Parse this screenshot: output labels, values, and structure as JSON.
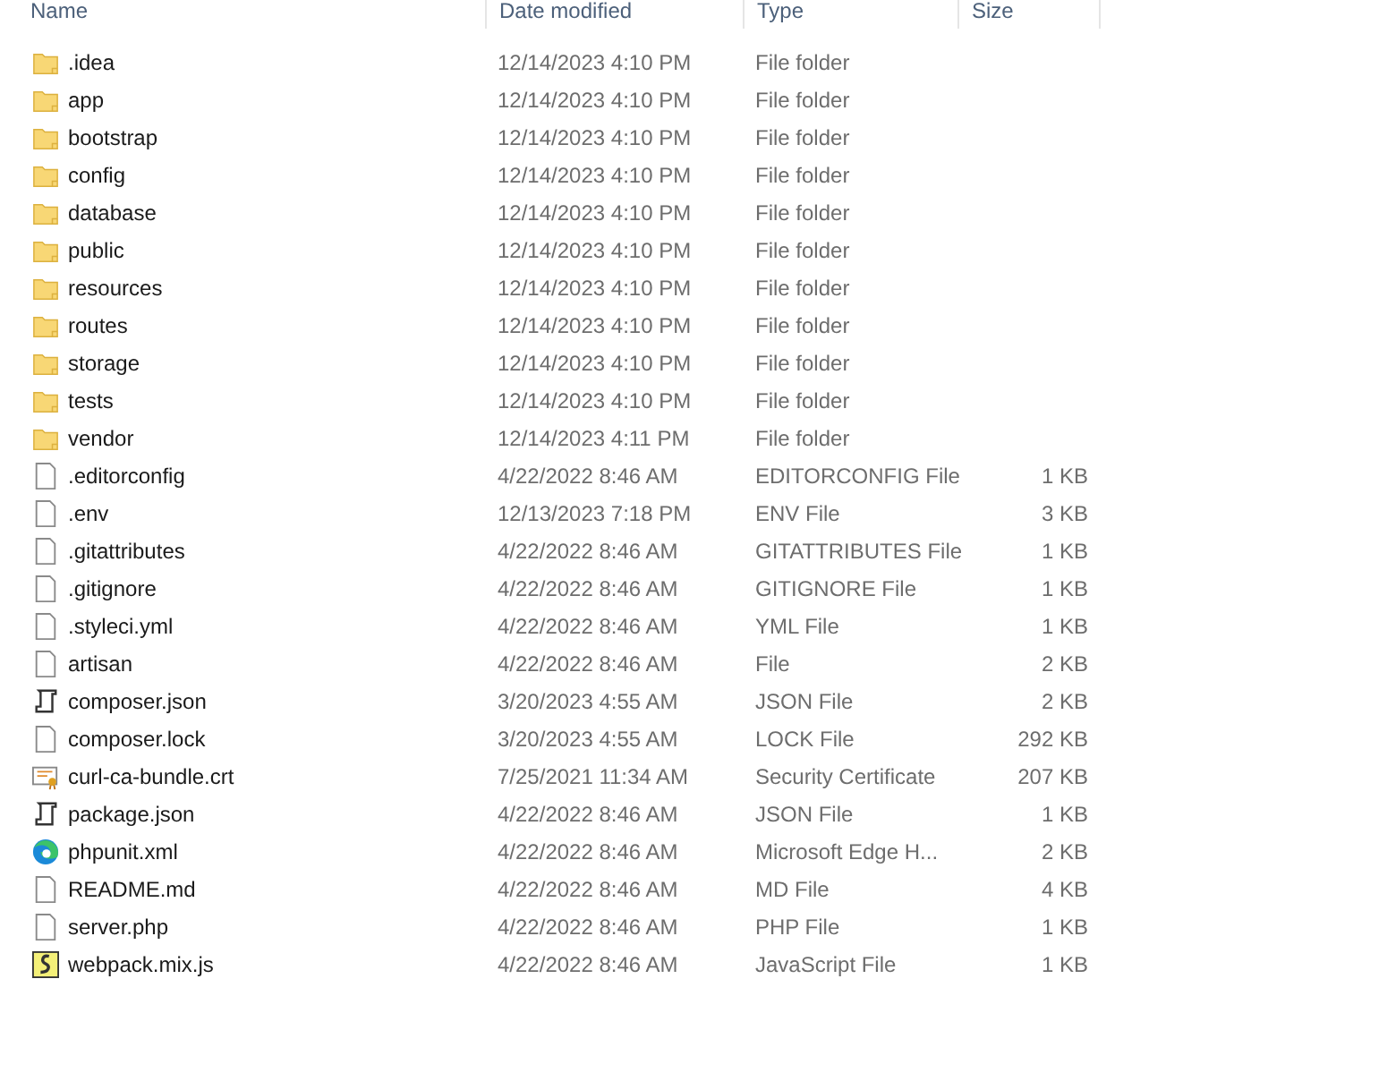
{
  "columns": [
    {
      "label": "Name"
    },
    {
      "label": "Date modified"
    },
    {
      "label": "Type"
    },
    {
      "label": "Size"
    }
  ],
  "rows": [
    {
      "name": ".idea",
      "date": "12/14/2023 4:10 PM",
      "type": "File folder",
      "kind": "folder"
    },
    {
      "name": "app",
      "date": "12/14/2023 4:10 PM",
      "type": "File folder",
      "kind": "folder"
    },
    {
      "name": "bootstrap",
      "date": "12/14/2023 4:10 PM",
      "type": "File folder",
      "kind": "folder"
    },
    {
      "name": "config",
      "date": "12/14/2023 4:10 PM",
      "type": "File folder",
      "kind": "folder"
    },
    {
      "name": "database",
      "date": "12/14/2023 4:10 PM",
      "type": "File folder",
      "kind": "folder"
    },
    {
      "name": "public",
      "date": "12/14/2023 4:10 PM",
      "type": "File folder",
      "kind": "folder"
    },
    {
      "name": "resources",
      "date": "12/14/2023 4:10 PM",
      "type": "File folder",
      "kind": "folder"
    },
    {
      "name": "routes",
      "date": "12/14/2023 4:10 PM",
      "type": "File folder",
      "kind": "folder"
    },
    {
      "name": "storage",
      "date": "12/14/2023 4:10 PM",
      "type": "File folder",
      "kind": "folder"
    },
    {
      "name": "tests",
      "date": "12/14/2023 4:10 PM",
      "type": "File folder",
      "kind": "folder"
    },
    {
      "name": "vendor",
      "date": "12/14/2023 4:11 PM",
      "type": "File folder",
      "kind": "folder"
    },
    {
      "name": ".editorconfig",
      "date": "4/22/2022 8:46 AM",
      "type": "EDITORCONFIG File",
      "size": "1 KB",
      "kind": "file"
    },
    {
      "name": ".env",
      "date": "12/13/2023 7:18 PM",
      "type": "ENV File",
      "size": "3 KB",
      "kind": "file"
    },
    {
      "name": ".gitattributes",
      "date": "4/22/2022 8:46 AM",
      "type": "GITATTRIBUTES File",
      "size": "1 KB",
      "kind": "file"
    },
    {
      "name": ".gitignore",
      "date": "4/22/2022 8:46 AM",
      "type": "GITIGNORE File",
      "size": "1 KB",
      "kind": "file"
    },
    {
      "name": ".styleci.yml",
      "date": "4/22/2022 8:46 AM",
      "type": "YML File",
      "size": "1 KB",
      "kind": "file"
    },
    {
      "name": "artisan",
      "date": "4/22/2022 8:46 AM",
      "type": "File",
      "size": "2 KB",
      "kind": "file"
    },
    {
      "name": "composer.json",
      "date": "3/20/2023 4:55 AM",
      "type": "JSON File",
      "size": "2 KB",
      "kind": "scroll"
    },
    {
      "name": "composer.lock",
      "date": "3/20/2023 4:55 AM",
      "type": "LOCK File",
      "size": "292 KB",
      "kind": "file"
    },
    {
      "name": "curl-ca-bundle.crt",
      "date": "7/25/2021 11:34 AM",
      "type": "Security Certificate",
      "size": "207 KB",
      "kind": "certificate"
    },
    {
      "name": "package.json",
      "date": "4/22/2022 8:46 AM",
      "type": "JSON File",
      "size": "1 KB",
      "kind": "scroll"
    },
    {
      "name": "phpunit.xml",
      "date": "4/22/2022 8:46 AM",
      "type": "Microsoft Edge H...",
      "size": "2 KB",
      "kind": "browser"
    },
    {
      "name": "README.md",
      "date": "4/22/2022 8:46 AM",
      "type": "MD File",
      "size": "4 KB",
      "kind": "file"
    },
    {
      "name": "server.php",
      "date": "4/22/2022 8:46 AM",
      "type": "PHP File",
      "size": "1 KB",
      "kind": "file"
    },
    {
      "name": "webpack.mix.js",
      "date": "4/22/2022 8:46 AM",
      "type": "JavaScript File",
      "size": "1 KB",
      "kind": "script"
    }
  ]
}
